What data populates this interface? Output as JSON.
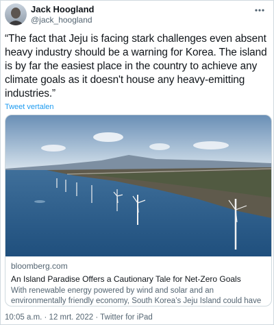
{
  "tweet": {
    "author_name": "Jack Hoogland",
    "author_handle": "@jack_hoogland",
    "text": "“The fact that Jeju is facing stark challenges even absent heavy industry should be a warning for Korea. The island is by far the easiest place in the country to achieve any climate goals as it doesn't house any heavy-emitting industries.”",
    "translate_label": "Tweet vertalen",
    "more_icon": "more-dots-icon",
    "timestamp": "10:05 a.m. · 12 mrt. 2022 · Twitter for iPad"
  },
  "link_card": {
    "domain": "bloomberg.com",
    "title": "An Island Paradise Offers a Cautionary Tale for Net-Zero Goals",
    "description": "With renewable energy powered by wind and solar and an environmentally friendly economy, South Korea’s Jeju Island could have been a perfect place to …",
    "image": "offshore-wind-turbines-coastline-photo"
  },
  "colors": {
    "text_primary": "#0f1419",
    "text_secondary": "#536471",
    "link_blue": "#1d9bf0",
    "border": "#cfd9de"
  }
}
